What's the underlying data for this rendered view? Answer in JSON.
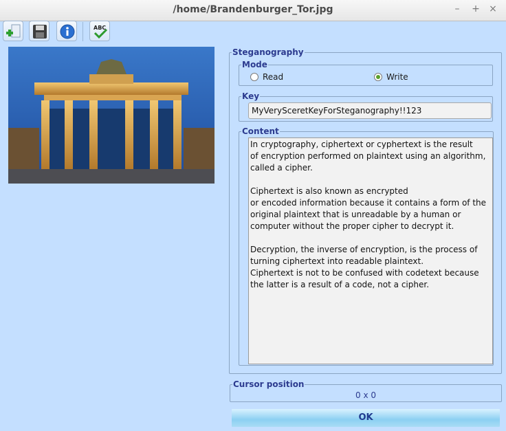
{
  "window": {
    "title": "/home/Brandenburger_Tor.jpg",
    "minimize": "–",
    "maximize": "+",
    "close": "×"
  },
  "toolbar": {
    "buttons": [
      "open-icon",
      "save-icon",
      "info-icon",
      "spellcheck-icon"
    ],
    "spellcheck_text": "ABC"
  },
  "steganography": {
    "label": "Steganography",
    "mode": {
      "label": "Mode",
      "read": "Read",
      "write": "Write",
      "selected": "Write"
    },
    "key": {
      "label": "Key",
      "value": "MyVerySceretKeyForSteganography!!123"
    },
    "content": {
      "label": "Content",
      "text": "In cryptography, ciphertext or cyphertext is the result\nof encryption performed on plaintext using an algorithm,\ncalled a cipher.\n\nCiphertext is also known as encrypted\nor encoded information because it contains a form of the\noriginal plaintext that is unreadable by a human or\ncomputer without the proper cipher to decrypt it.\n\nDecryption, the inverse of encryption, is the process of\nturning ciphertext into readable plaintext.\nCiphertext is not to be confused with codetext because\nthe latter is a result of a code, not a cipher."
    }
  },
  "cursor": {
    "label": "Cursor position",
    "value": "0 x 0"
  },
  "ok_label": "OK",
  "colors": {
    "background": "#c4dfff",
    "accent": "#2c3b8f",
    "ok_button": "#8cd0f2"
  }
}
